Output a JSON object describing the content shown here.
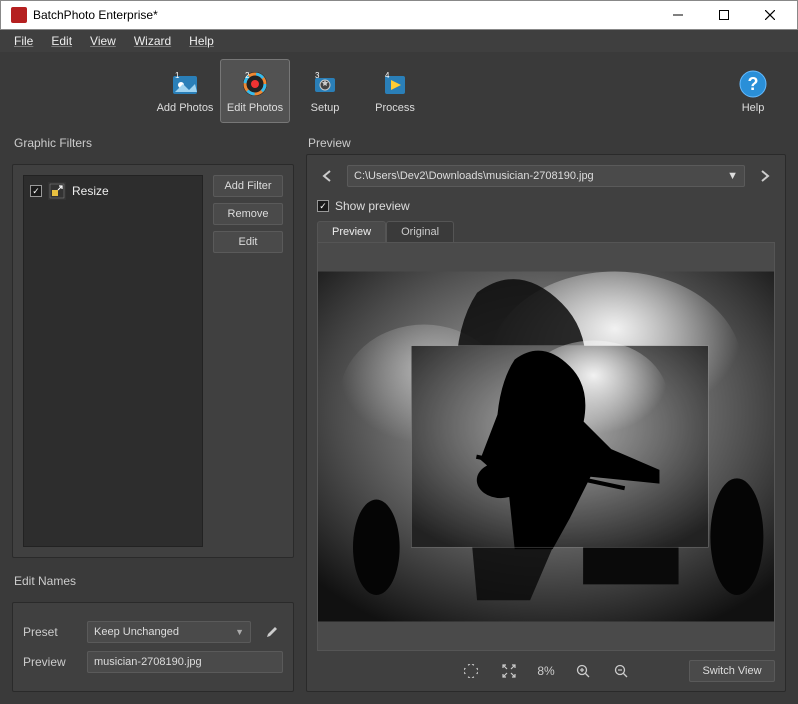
{
  "window": {
    "title": "BatchPhoto Enterprise*"
  },
  "menu": {
    "file": "File",
    "edit": "Edit",
    "view": "View",
    "wizard": "Wizard",
    "help": "Help"
  },
  "toolbar": {
    "add_photos": "Add Photos",
    "edit_photos": "Edit Photos",
    "setup": "Setup",
    "process": "Process",
    "help": "Help",
    "step1": "1",
    "step2": "2",
    "step3": "3",
    "step4": "4"
  },
  "left": {
    "graphic_filters_label": "Graphic Filters",
    "filter_items": [
      {
        "checked": true,
        "name": "Resize"
      }
    ],
    "add_filter": "Add Filter",
    "remove": "Remove",
    "edit": "Edit",
    "edit_names_label": "Edit Names",
    "preset_label": "Preset",
    "preset_value": "Keep Unchanged",
    "preview_label": "Preview",
    "preview_value": "musician-2708190.jpg"
  },
  "right": {
    "preview_label": "Preview",
    "path": "C:\\Users\\Dev2\\Downloads\\musician-2708190.jpg",
    "show_preview": "Show preview",
    "show_preview_checked": true,
    "tab_preview": "Preview",
    "tab_original": "Original",
    "zoom_pct": "8%",
    "switch_view": "Switch View"
  }
}
